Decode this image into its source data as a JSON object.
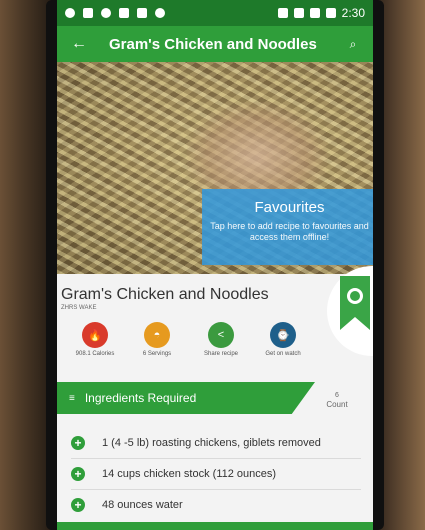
{
  "status_bar": {
    "time": "2:30"
  },
  "app_bar": {
    "back_icon": "←",
    "title": "Gram's Chicken and Noodles",
    "search_icon": "⌕"
  },
  "favourites_tip": {
    "title": "Favourites",
    "body": "Tap here to add recipe to favourites and access them offline!"
  },
  "recipe": {
    "title": "Gram's Chicken and Noodles",
    "subtitle": "ZHRS WAKE",
    "stats": [
      {
        "label": "908.1 Calories",
        "icon": "flame-icon",
        "glyph": "🔥",
        "color": "#d93a2b"
      },
      {
        "label": "6 Servings",
        "icon": "dish-icon",
        "glyph": "◓",
        "color": "#e69a1f"
      },
      {
        "label": "Share recipe",
        "icon": "share-icon",
        "glyph": "<",
        "color": "#3b9a3f"
      },
      {
        "label": "Get on watch",
        "icon": "watch-icon",
        "glyph": "⌚",
        "color": "#1e5f8a"
      }
    ]
  },
  "ingredients": {
    "header": "Ingredients Required",
    "header_icon": "≡",
    "count_value": "6",
    "count_label": "Count",
    "items": [
      "1 (4 -5 lb) roasting chickens, giblets removed",
      "14 cups chicken stock (112 ounces)",
      "48 ounces water"
    ],
    "add_glyph": "+"
  },
  "colors": {
    "primary": "#2f9e3a",
    "status_bar": "#1e7a2a",
    "tooltip": "#3498db"
  }
}
